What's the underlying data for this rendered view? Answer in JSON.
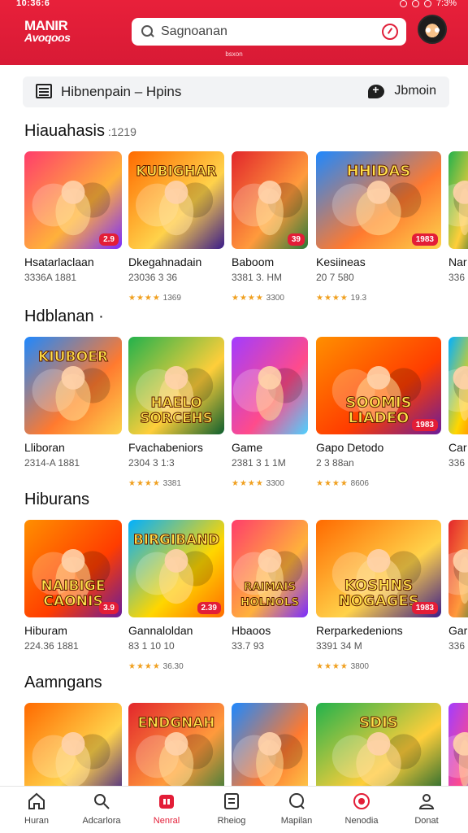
{
  "status": {
    "time": "10:36:6",
    "right": "7:3%"
  },
  "header": {
    "logo_line1": "MANIR",
    "logo_line2": "Avoqoos",
    "search_placeholder": "Sagnoanan",
    "subtitle": "bsxon"
  },
  "filter": {
    "label": "Hibnenpain – Hpins",
    "action": "Jbmoin"
  },
  "sections": [
    {
      "title": "Hiauahasis",
      "count": ":1219",
      "cards": [
        {
          "title": "Hsatarlaclaan",
          "meta": "3336A 1881",
          "rating": "",
          "tag": "2.9"
        },
        {
          "title": "Dkegahnadain",
          "meta": "23036 3 36",
          "rating": "1369",
          "tag": ""
        },
        {
          "title": "Baboom",
          "meta": "3381 3. HM",
          "rating": "3300",
          "tag": "39"
        },
        {
          "title": "Kesiineas",
          "meta": "20 7 580",
          "rating": "19.3",
          "tag": "1983"
        },
        {
          "title": "Nar",
          "meta": "336",
          "rating": "",
          "tag": ""
        }
      ]
    },
    {
      "title": "Hdblanan ·",
      "count": "",
      "cards": [
        {
          "title": "Lliboran",
          "meta": "2314-A 1881",
          "rating": "",
          "tag": ""
        },
        {
          "title": "Fvachabeniors",
          "meta": "2304 3 1:3",
          "rating": "3381",
          "tag": ""
        },
        {
          "title": "Game",
          "meta": "2381 3 1 1M",
          "rating": "3300",
          "tag": ""
        },
        {
          "title": "Gapo Detodo",
          "meta": "2 3 88an",
          "rating": "8606",
          "tag": "1983"
        },
        {
          "title": "Car",
          "meta": "336",
          "rating": "",
          "tag": ""
        }
      ]
    },
    {
      "title": "Hiburans",
      "count": "",
      "cards": [
        {
          "title": "Hiburam",
          "meta": "224.36 1881",
          "rating": "",
          "tag": "3.9"
        },
        {
          "title": "Gannaloldan",
          "meta": "83 1 10 10",
          "rating": "36.30",
          "tag": "2.39"
        },
        {
          "title": "Hbaoos",
          "meta": "33.7 93",
          "rating": "",
          "tag": ""
        },
        {
          "title": "Rerparkedenions",
          "meta": "3391 34 M",
          "rating": "3800",
          "tag": "1983"
        },
        {
          "title": "Gar",
          "meta": "336",
          "rating": "",
          "tag": ""
        }
      ]
    },
    {
      "title": "Aamngans",
      "count": "",
      "cards": [
        {},
        {},
        {},
        {},
        {}
      ]
    }
  ],
  "art": {
    "s0": [
      {
        "lines": [
          "",
          ""
        ]
      },
      {
        "lines": [
          "KUBIGHAR",
          ""
        ]
      },
      {
        "lines": [
          "",
          ""
        ]
      },
      {
        "lines": [
          "HHIDAS",
          ""
        ]
      },
      {
        "lines": [
          "",
          ""
        ]
      }
    ],
    "s1": [
      {
        "lines": [
          "KIUBOER",
          ""
        ]
      },
      {
        "lines": [
          "HAELO",
          "SORCEHS"
        ]
      },
      {
        "lines": [
          "",
          ""
        ]
      },
      {
        "lines": [
          "SOOMIS",
          "LIADEO"
        ]
      },
      {
        "lines": [
          "",
          ""
        ]
      }
    ],
    "s2": [
      {
        "lines": [
          "NAIBIGE",
          "CAONIS"
        ]
      },
      {
        "lines": [
          "BIRGIBAND",
          ""
        ]
      },
      {
        "lines": [
          "RAIMAIS",
          "HOLNOLS"
        ]
      },
      {
        "lines": [
          "KOSHNS",
          "NOGAGES"
        ]
      },
      {
        "lines": [
          "",
          ""
        ]
      }
    ],
    "s3": [
      {
        "lines": [
          "",
          ""
        ]
      },
      {
        "lines": [
          "ENDGNAH",
          ""
        ]
      },
      {
        "lines": [
          "",
          ""
        ]
      },
      {
        "lines": [
          "SDIS",
          ""
        ]
      },
      {
        "lines": [
          "",
          ""
        ]
      }
    ]
  },
  "nav": [
    {
      "label": "Huran",
      "icon": "home-icon",
      "active": false
    },
    {
      "label": "Adcarlora",
      "icon": "search-icon",
      "active": false
    },
    {
      "label": "Nenral",
      "icon": "games-icon",
      "active": true
    },
    {
      "label": "Rheiog",
      "icon": "list-icon",
      "active": false
    },
    {
      "label": "Mapilan",
      "icon": "chat-bubble-icon",
      "active": false
    },
    {
      "label": "Nenodia",
      "icon": "record-icon",
      "active": false
    },
    {
      "label": "Donat",
      "icon": "profile-icon",
      "active": false
    }
  ],
  "colors": {
    "accent": "#e31d37",
    "header": "#e0203a",
    "stars": "#f0a020"
  }
}
